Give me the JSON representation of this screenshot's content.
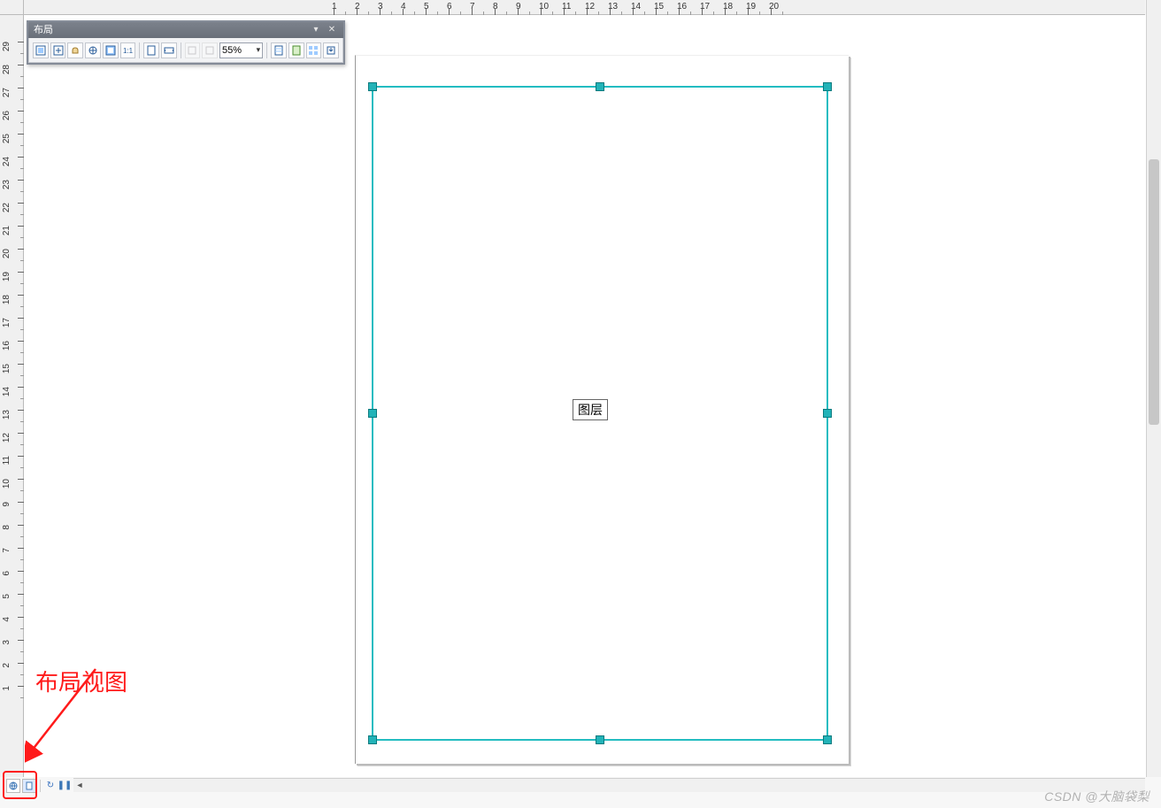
{
  "panel": {
    "title": "布局",
    "zoom": "55%",
    "buttons": [
      {
        "name": "pan-extent-icon"
      },
      {
        "name": "zoom-in-icon"
      },
      {
        "name": "pan-hand-icon"
      },
      {
        "name": "full-extent-icon"
      },
      {
        "name": "zoom-selected-icon"
      },
      {
        "name": "one-to-one-icon"
      },
      {
        "name": "fit-page-icon"
      },
      {
        "name": "fit-width-icon"
      },
      {
        "name": "disabled-1-icon"
      },
      {
        "name": "disabled-2-icon"
      }
    ],
    "right_buttons": [
      {
        "name": "toggle-guides-icon"
      },
      {
        "name": "page-setup-icon"
      },
      {
        "name": "grid-options-icon"
      },
      {
        "name": "export-icon"
      }
    ]
  },
  "page_label": "图层",
  "annotation": {
    "text": "布局视图"
  },
  "watermark": "CSDN @大脑袋梨",
  "ruler": {
    "h_labels": [
      "1",
      "2",
      "3",
      "4",
      "5",
      "6",
      "7",
      "8",
      "9",
      "10",
      "11",
      "12",
      "13",
      "14",
      "15",
      "16",
      "17",
      "18",
      "19",
      "20"
    ],
    "v_labels": [
      "29",
      "28",
      "27",
      "26",
      "25",
      "24",
      "23",
      "22",
      "21",
      "20",
      "19",
      "18",
      "17",
      "16",
      "15",
      "14",
      "13",
      "12",
      "11",
      "10",
      "9",
      "8",
      "7",
      "6",
      "5",
      "4",
      "3",
      "2",
      "1"
    ]
  },
  "status": {
    "data_view_btn": "▫",
    "layout_view_btn": "▫"
  }
}
